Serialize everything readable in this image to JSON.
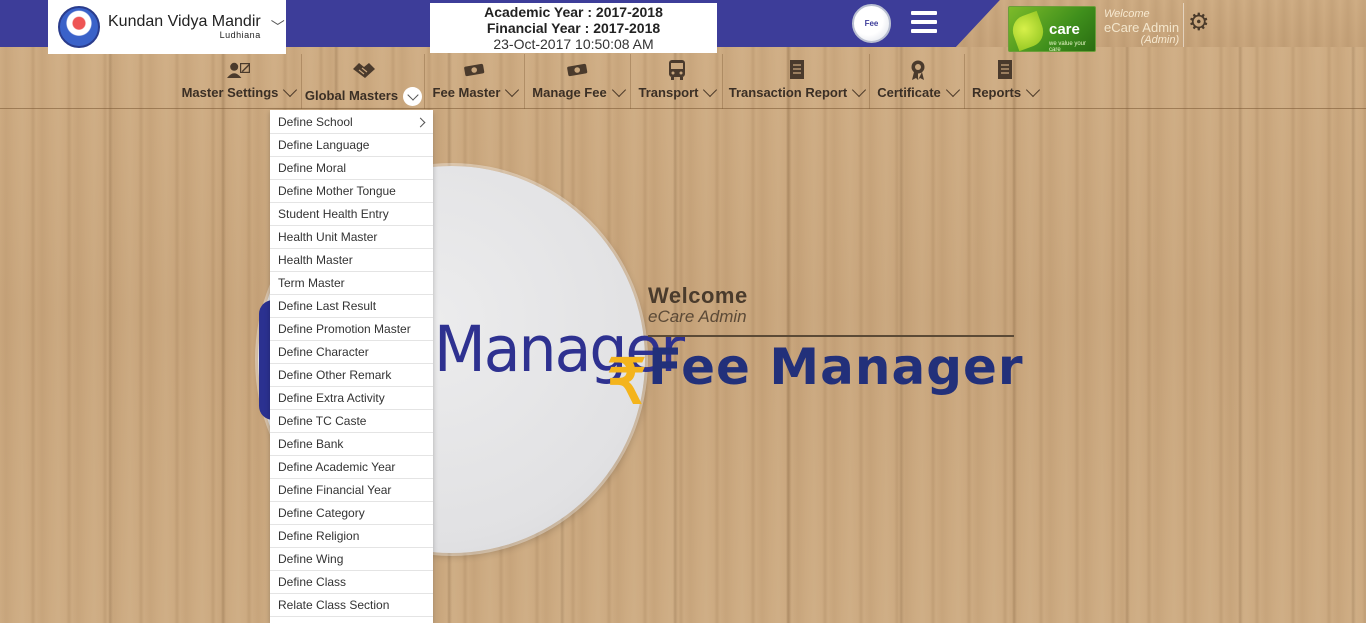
{
  "header": {
    "school_name": "Kundan Vidya Mandir",
    "school_city": "Ludhiana",
    "academic_year": "Academic Year : 2017-2018",
    "financial_year": "Financial Year : 2017-2018",
    "datetime": "23-Oct-2017 10:50:08 AM",
    "ecare_brand": "care",
    "ecare_tagline": "we value your care",
    "welcome_small": "Welcome",
    "user_name": "eCare Admin",
    "user_role": "(Admin)"
  },
  "menu": {
    "items": [
      {
        "label": "Master Settings",
        "icon": "settings-user-icon"
      },
      {
        "label": "Global Masters",
        "icon": "handshake-icon",
        "active": true
      },
      {
        "label": "Fee Master",
        "icon": "money-icon"
      },
      {
        "label": "Manage Fee",
        "icon": "money-icon"
      },
      {
        "label": "Transport",
        "icon": "bus-icon"
      },
      {
        "label": "Transaction Report",
        "icon": "report-icon"
      },
      {
        "label": "Certificate",
        "icon": "award-icon"
      },
      {
        "label": "Reports",
        "icon": "report-icon"
      }
    ]
  },
  "dropdown": {
    "items": [
      "Define School",
      "Define Language",
      "Define Moral",
      "Define Mother Tongue",
      "Student Health Entry",
      "Health Unit Master",
      "Health Master",
      "Term Master",
      "Define Last Result",
      "Define Promotion Master",
      "Define Character",
      "Define Other Remark",
      "Define Extra Activity",
      "Define TC Caste",
      "Define Bank",
      "Define Academic Year",
      "Define Financial Year",
      "Define Category",
      "Define Religion",
      "Define Wing",
      "Define Class",
      "Relate Class Section"
    ]
  },
  "hero": {
    "logo_text": "Manager",
    "rupee": "₹",
    "welcome": "Welcome",
    "user": "eCare Admin",
    "title": "Fee Manager"
  },
  "colors": {
    "topbar": "#3d3d99",
    "title_blue": "#22307a",
    "rupee_gold": "#f4b41c"
  }
}
